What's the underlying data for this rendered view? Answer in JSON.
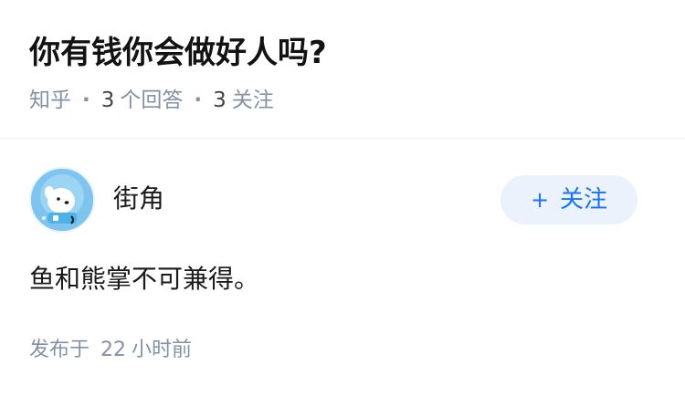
{
  "question": {
    "title": "你有钱你会做好人吗?",
    "source": "知乎",
    "answer_count": "3",
    "answer_label": "个回答",
    "follow_count": "3",
    "follow_label": "关注"
  },
  "answer": {
    "author_name": "街角",
    "avatar_icon": "astronaut-dog-avatar",
    "follow_button_label": "关注",
    "follow_button_icon": "plus-icon",
    "content": "鱼和熊掌不可兼得。",
    "published_prefix": "发布于",
    "published_num": "22",
    "published_suffix": "小时前"
  },
  "colors": {
    "accent": "#1772f6",
    "follow_button_bg": "#ebf2fb",
    "meta_gray": "#8590a6",
    "avatar_bg": "#7ec4ee"
  }
}
